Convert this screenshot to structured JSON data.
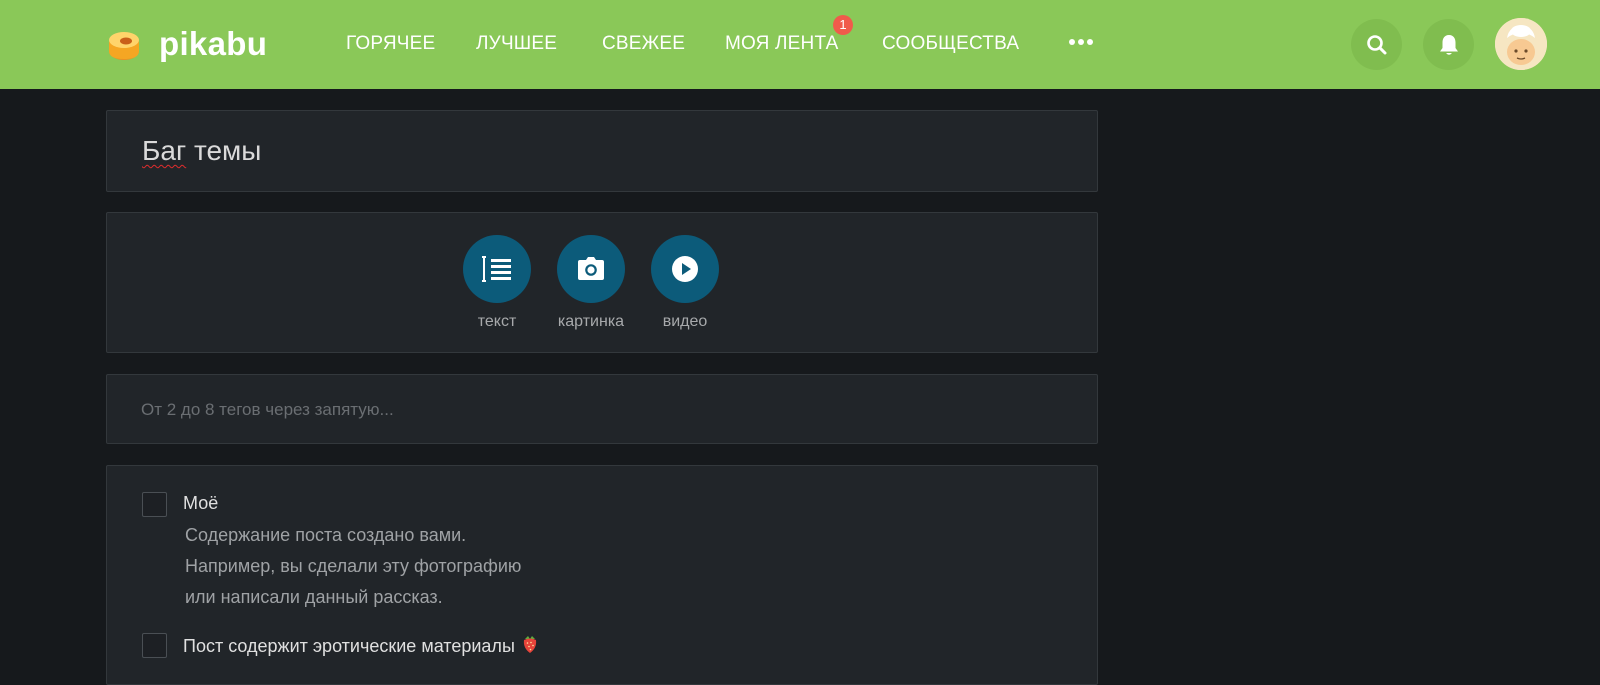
{
  "header": {
    "logo_text": "pikabu",
    "nav": [
      {
        "label": "ГОРЯЧЕЕ"
      },
      {
        "label": "ЛУЧШЕЕ"
      },
      {
        "label": "СВЕЖЕЕ"
      },
      {
        "label": "МОЯ ЛЕНТА"
      },
      {
        "label": "СООБЩЕСТВА"
      }
    ],
    "feed_badge": "1",
    "icons": [
      "more-dots-icon",
      "search-icon",
      "bell-icon",
      "avatar"
    ]
  },
  "editor": {
    "title_word1": "Баг",
    "title_word2": " темы",
    "media_buttons": [
      {
        "label": "текст",
        "icon": "text-block-icon"
      },
      {
        "label": "картинка",
        "icon": "camera-icon"
      },
      {
        "label": "видео",
        "icon": "play-icon"
      }
    ],
    "tags_placeholder": "От 2 до 8 тегов через запятую...",
    "options": [
      {
        "label": "Моё",
        "description": [
          "Содержание поста создано вами.",
          "Например, вы сделали эту фотографию",
          "или написали данный рассказ."
        ]
      },
      {
        "label": "Пост содержит эротические материалы",
        "icon": "strawberry-icon"
      }
    ]
  },
  "colors": {
    "header_bg": "#8ac858",
    "page_bg": "#16191c",
    "panel_bg": "#212529",
    "accent_circle": "#0c5b7a",
    "badge": "#f05b4b"
  }
}
